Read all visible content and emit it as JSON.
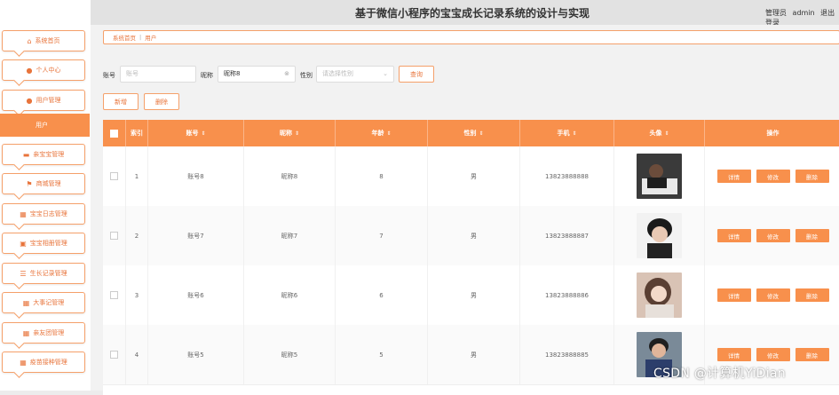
{
  "header": {
    "title": "基于微信小程序的宝宝成长记录系统的设计与实现",
    "role": "管理员",
    "username": "admin",
    "logout": "退出登录"
  },
  "sidebar": {
    "items": [
      {
        "label": "系统首页",
        "icon": "home-icon"
      },
      {
        "label": "个人中心",
        "icon": "person-icon"
      },
      {
        "label": "用户管理",
        "icon": "user-admin-icon"
      },
      {
        "label": "亲宝宝管理",
        "icon": "baby-icon"
      },
      {
        "label": "商城管理",
        "icon": "flag-icon"
      },
      {
        "label": "宝宝日志管理",
        "icon": "grid-icon"
      },
      {
        "label": "宝宝相册管理",
        "icon": "album-icon"
      },
      {
        "label": "生长记录管理",
        "icon": "list-icon"
      },
      {
        "label": "大事记管理",
        "icon": "grid-icon"
      },
      {
        "label": "亲友团管理",
        "icon": "grid-icon"
      },
      {
        "label": "疫苗接种管理",
        "icon": "grid-icon"
      }
    ],
    "active_sub": "用户"
  },
  "breadcrumb": {
    "home": "系统首页",
    "separator": "|",
    "current": "用户"
  },
  "search": {
    "account_label": "账号",
    "account_placeholder": "账号",
    "nickname_label": "昵称",
    "nickname_value": "昵称8",
    "gender_label": "性别",
    "gender_placeholder": "请选择性别",
    "query_button": "查询"
  },
  "actions": {
    "add": "新增",
    "delete": "删除"
  },
  "table": {
    "columns": [
      "",
      "索引",
      "账号",
      "昵称",
      "年龄",
      "性别",
      "手机",
      "头像",
      "操作"
    ],
    "rows": [
      {
        "index": "1",
        "account": "账号8",
        "nickname": "昵称8",
        "age": "8",
        "gender": "男",
        "phone": "13823888888"
      },
      {
        "index": "2",
        "account": "账号7",
        "nickname": "昵称7",
        "age": "7",
        "gender": "男",
        "phone": "13823888887"
      },
      {
        "index": "3",
        "account": "账号6",
        "nickname": "昵称6",
        "age": "6",
        "gender": "男",
        "phone": "13823888886"
      },
      {
        "index": "4",
        "account": "账号5",
        "nickname": "昵称5",
        "age": "5",
        "gender": "男",
        "phone": "13823888885"
      }
    ],
    "row_actions": {
      "detail": "详情",
      "edit": "修改",
      "delete": "删除"
    }
  },
  "watermark": "CSDN @计算机YiDian",
  "colors": {
    "accent": "#f8904c",
    "accent_text": "#e8743b"
  }
}
